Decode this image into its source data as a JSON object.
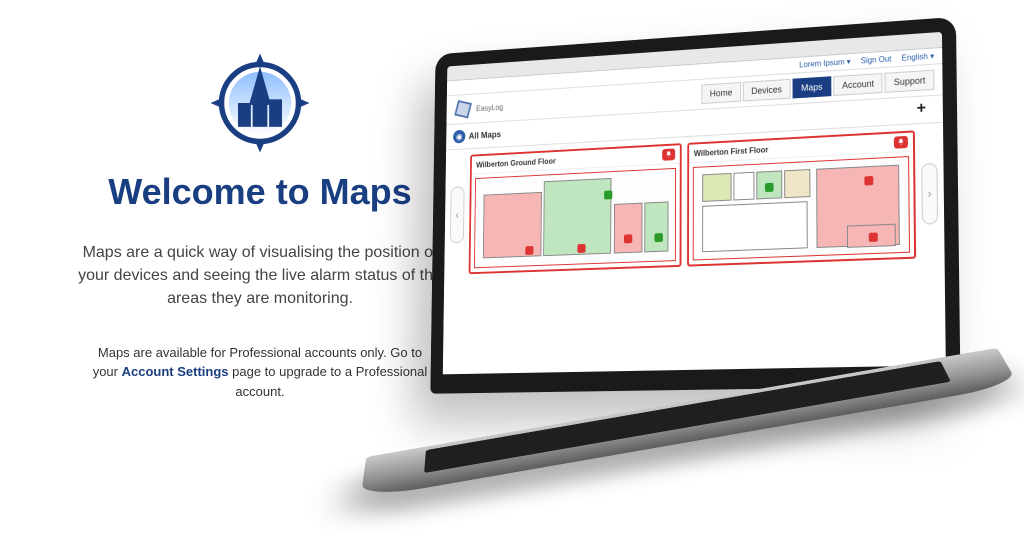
{
  "left": {
    "title": "Welcome to Maps",
    "description": "Maps are a quick way of visualising the position of your devices and seeing the live alarm status of the areas they are monitoring.",
    "note_pre": "Maps are available for Professional accounts only. Go to your ",
    "note_bold": "Account Settings",
    "note_post": " page to upgrade to a Professional account."
  },
  "screen": {
    "util": {
      "user": "Lorem Ipsum ▾",
      "signout": "Sign Out",
      "lang": "English ▾"
    },
    "brand": "EasyLog",
    "tabs": {
      "home": "Home",
      "devices": "Devices",
      "maps": "Maps",
      "account": "Account",
      "support": "Support"
    },
    "sub": {
      "title": "All Maps",
      "plus": "+",
      "prev": "‹",
      "next": "›"
    },
    "map1": {
      "title": "Wilberton Ground Floor"
    },
    "map2": {
      "title": "Wilberton First Floor"
    }
  }
}
